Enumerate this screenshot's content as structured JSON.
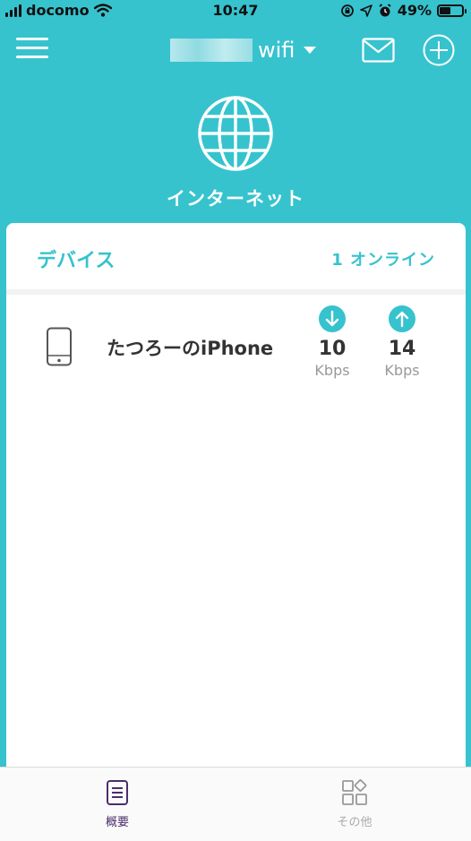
{
  "status_bar": {
    "carrier": "docomo",
    "time": "10:47",
    "battery": "49%",
    "battery_level": 0.49
  },
  "header": {
    "network_name": "wifi",
    "icons": [
      "menu-icon",
      "caret-down-icon",
      "mail-icon",
      "add-circle-icon"
    ]
  },
  "internet": {
    "label": "インターネット",
    "icon": "globe-icon"
  },
  "devices": {
    "title": "デバイス",
    "online_count": "1 オンライン",
    "items": [
      {
        "name": "たつろーのiPhone",
        "icon": "phone-icon",
        "download": {
          "value": "10",
          "unit": "Kbps"
        },
        "upload": {
          "value": "14",
          "unit": "Kbps"
        }
      }
    ]
  },
  "tabbar": {
    "tabs": [
      {
        "label": "概要",
        "icon": "overview-icon",
        "active": true
      },
      {
        "label": "その他",
        "icon": "more-grid-icon",
        "active": false
      }
    ]
  },
  "colors": {
    "accent": "#36c3ce",
    "active_tab": "#4a2e6b",
    "inactive_tab": "#aaaaaa"
  }
}
